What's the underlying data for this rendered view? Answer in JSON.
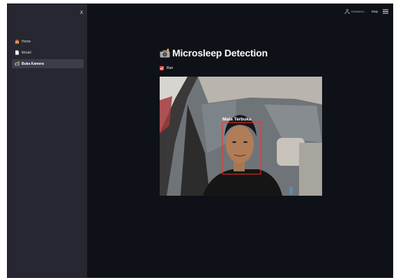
{
  "sidebar": {
    "close_label": "x",
    "items": [
      {
        "label": "Home",
        "icon": "home-icon"
      },
      {
        "label": "Model",
        "icon": "document-icon"
      },
      {
        "label": "Buka Kamera",
        "icon": "camera-icon",
        "active": true
      }
    ]
  },
  "topbar": {
    "status_text": "RUNNING...",
    "stop_label": "Stop",
    "menu_icon": "hamburger-menu-icon"
  },
  "main": {
    "title": "Microsleep Detection",
    "title_icon": "camera-flash-icon",
    "run_checkbox": {
      "label": "Run",
      "checked": true
    },
    "camera_feed": {
      "detection_label": "Mata Terbuka",
      "box_color": "#ff2a2a"
    }
  },
  "colors": {
    "sidebar_bg": "#262730",
    "main_bg": "#0e1117",
    "accent": "#ff4b4b",
    "text": "#fafafa"
  }
}
